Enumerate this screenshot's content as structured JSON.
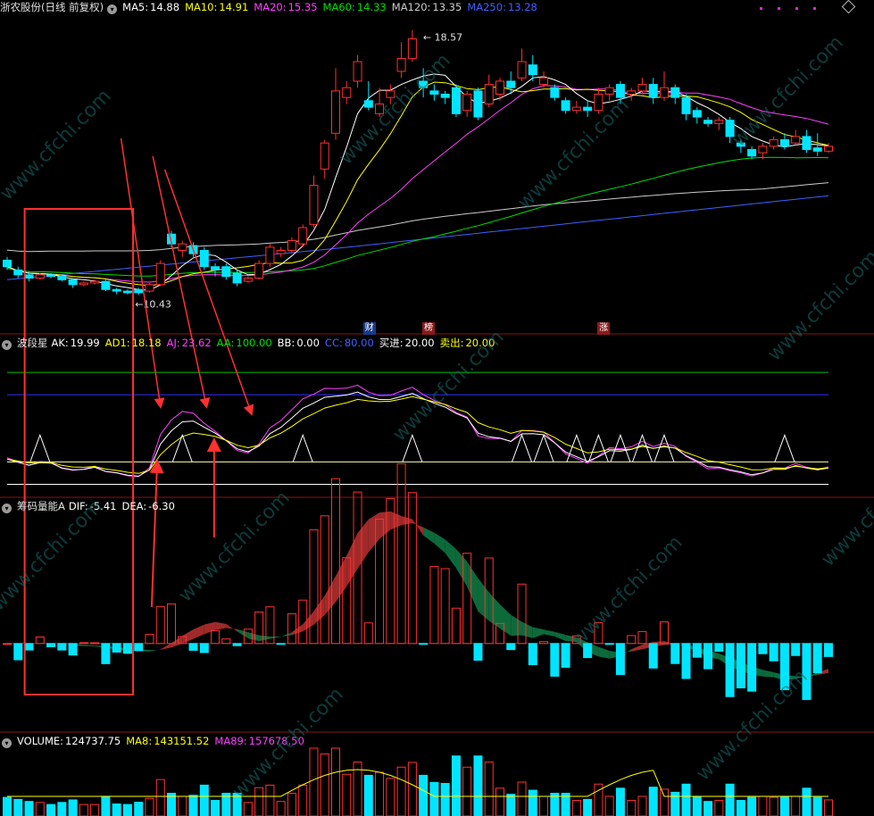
{
  "chart_data": {
    "type": "candlestick",
    "main_panel": {
      "title": "浙农股份(日线 前复权)",
      "indicators": [
        {
          "label": "MA5:",
          "value": "14.88",
          "color": "#ffffff"
        },
        {
          "label": "MA10:",
          "value": "14.91",
          "color": "#ffff00"
        },
        {
          "label": "MA20:",
          "value": "15.35",
          "color": "#ff40ff"
        },
        {
          "label": "MA60:",
          "value": "14.33",
          "color": "#00e000"
        },
        {
          "label": "MA120:",
          "value": "13.35",
          "color": "#cccccc"
        },
        {
          "label": "MA250:",
          "value": "13.28",
          "color": "#4060ff"
        }
      ],
      "ylim": [
        9.4,
        19.0
      ],
      "high_mark": "18.57",
      "low_mark": "10.43",
      "event_tags": [
        {
          "text": "财",
          "bg": "#1a3a8a"
        },
        {
          "text": "榜",
          "bg": "#8a1a1a"
        },
        {
          "text": "涨",
          "bg": "#8a1a1a"
        }
      ],
      "candles": [
        [
          11.5,
          11.3,
          11.6,
          11.2
        ],
        [
          11.2,
          11.05,
          11.3,
          10.95
        ],
        [
          11.05,
          10.95,
          11.15,
          10.85
        ],
        [
          10.95,
          11.05,
          11.1,
          10.9
        ],
        [
          11.05,
          11.0,
          11.1,
          10.95
        ],
        [
          11.0,
          10.9,
          11.05,
          10.85
        ],
        [
          10.9,
          10.75,
          10.95,
          10.65
        ],
        [
          10.75,
          10.8,
          10.85,
          10.7
        ],
        [
          10.8,
          10.85,
          10.9,
          10.75
        ],
        [
          10.85,
          10.6,
          10.9,
          10.55
        ],
        [
          10.6,
          10.55,
          10.65,
          10.45
        ],
        [
          10.55,
          10.5,
          10.6,
          10.45
        ],
        [
          10.6,
          10.5,
          10.65,
          10.43
        ],
        [
          10.55,
          10.75,
          10.8,
          10.5
        ],
        [
          10.75,
          11.4,
          11.5,
          10.7
        ],
        [
          12.3,
          12.0,
          12.4,
          11.9
        ],
        [
          11.8,
          12.0,
          12.1,
          11.6
        ],
        [
          11.95,
          11.7,
          12.05,
          11.6
        ],
        [
          11.8,
          11.3,
          11.9,
          11.2
        ],
        [
          11.3,
          11.2,
          11.4,
          11.0
        ],
        [
          11.3,
          11.0,
          11.4,
          10.9
        ],
        [
          11.1,
          10.8,
          11.2,
          10.7
        ],
        [
          10.85,
          10.95,
          11.0,
          10.8
        ],
        [
          10.95,
          11.4,
          11.5,
          10.9
        ],
        [
          11.4,
          11.9,
          12.0,
          11.3
        ],
        [
          11.7,
          11.8,
          11.9,
          11.6
        ],
        [
          11.8,
          12.1,
          12.2,
          11.7
        ],
        [
          12.0,
          12.5,
          12.6,
          11.9
        ],
        [
          12.6,
          13.8,
          14.1,
          12.5
        ],
        [
          14.3,
          15.1,
          15.2,
          14.0
        ],
        [
          15.4,
          16.7,
          17.4,
          15.2
        ],
        [
          16.5,
          16.8,
          17.0,
          16.3
        ],
        [
          17.0,
          17.6,
          17.8,
          16.8
        ],
        [
          16.4,
          16.2,
          17.0,
          16.1
        ],
        [
          16.0,
          16.3,
          16.8,
          15.9
        ],
        [
          16.5,
          16.7,
          16.9,
          16.3
        ],
        [
          17.3,
          17.7,
          18.2,
          17.1
        ],
        [
          17.7,
          18.3,
          18.57,
          17.6
        ],
        [
          17.0,
          16.8,
          17.4,
          16.5
        ],
        [
          16.7,
          16.6,
          16.9,
          16.4
        ],
        [
          16.6,
          16.5,
          16.7,
          16.3
        ],
        [
          16.8,
          16.0,
          16.9,
          15.9
        ],
        [
          16.1,
          16.6,
          16.7,
          15.9
        ],
        [
          16.7,
          15.9,
          16.8,
          15.8
        ],
        [
          16.3,
          16.9,
          17.2,
          16.2
        ],
        [
          16.6,
          17.0,
          17.1,
          16.4
        ],
        [
          17.0,
          16.8,
          17.3,
          16.6
        ],
        [
          17.1,
          17.6,
          18.0,
          17.0
        ],
        [
          17.5,
          17.2,
          17.8,
          17.0
        ],
        [
          16.9,
          17.1,
          17.3,
          16.8
        ],
        [
          16.8,
          16.5,
          16.9,
          16.4
        ],
        [
          16.4,
          16.1,
          16.5,
          16.0
        ],
        [
          16.1,
          16.2,
          16.4,
          16.0
        ],
        [
          16.2,
          16.1,
          16.4,
          15.9
        ],
        [
          16.1,
          16.6,
          16.8,
          16.0
        ],
        [
          16.6,
          16.8,
          16.9,
          16.4
        ],
        [
          16.9,
          16.5,
          17.0,
          16.3
        ],
        [
          16.6,
          16.7,
          16.8,
          16.4
        ],
        [
          16.7,
          16.9,
          17.1,
          16.6
        ],
        [
          16.9,
          16.5,
          17.1,
          16.3
        ],
        [
          16.5,
          16.8,
          17.3,
          16.4
        ],
        [
          16.8,
          16.5,
          16.9,
          16.3
        ],
        [
          16.5,
          16.0,
          16.6,
          15.8
        ],
        [
          16.1,
          15.9,
          16.2,
          15.7
        ],
        [
          15.8,
          15.7,
          15.9,
          15.6
        ],
        [
          15.7,
          15.8,
          15.9,
          15.5
        ],
        [
          15.8,
          15.3,
          15.9,
          15.1
        ],
        [
          15.1,
          15.0,
          15.2,
          14.8
        ],
        [
          14.9,
          14.7,
          15.0,
          14.6
        ],
        [
          14.8,
          15.0,
          15.1,
          14.6
        ],
        [
          15.0,
          15.2,
          15.3,
          14.9
        ],
        [
          15.2,
          15.0,
          15.4,
          14.9
        ],
        [
          15.1,
          15.3,
          15.5,
          15.0
        ],
        [
          15.3,
          14.9,
          15.5,
          14.8
        ],
        [
          14.95,
          14.85,
          15.4,
          14.7
        ],
        [
          14.85,
          15.0,
          15.1,
          14.8
        ]
      ]
    },
    "wave_panel": {
      "title": "波段星",
      "indicators": [
        {
          "label": "AK:",
          "value": "19.99",
          "color": "#ffffff"
        },
        {
          "label": "AD1:",
          "value": "18.18",
          "color": "#ffff00"
        },
        {
          "label": "AJ:",
          "value": "23.62",
          "color": "#ff40ff"
        },
        {
          "label": "AA:",
          "value": "100.00",
          "color": "#00e000"
        },
        {
          "label": "BB:",
          "value": "0.00",
          "color": "#ffffff"
        },
        {
          "label": "CC:",
          "value": "80.00",
          "color": "#4060ff"
        },
        {
          "label": "买进:",
          "value": "20.00",
          "color": "#ffffff"
        },
        {
          "label": "卖出:",
          "value": "20.00",
          "color": "#ffff00"
        }
      ],
      "ylim": [
        -10,
        120
      ],
      "reference_lines": [
        100,
        80,
        20,
        0
      ]
    },
    "chip_panel": {
      "title": "筹码量能A",
      "indicators": [
        {
          "label": "DIF:",
          "value": "-5.41",
          "color": "#ffffff"
        },
        {
          "label": "DEA:",
          "value": "-6.30",
          "color": "#ffffff"
        }
      ],
      "ylim": [
        -12,
        18
      ]
    },
    "volume_panel": {
      "title": "VOLUME:",
      "indicators": [
        {
          "label": "VOLUME:",
          "value": "124737.75",
          "color": "#ffffff"
        },
        {
          "label": "MA8:",
          "value": "143151.52",
          "color": "#ffff00"
        },
        {
          "label": "MA89:",
          "value": "157678.50",
          "color": "#ff40ff"
        }
      ]
    },
    "colors": {
      "up": "#ff3030",
      "down": "#00e5ff",
      "area_up": "#a02a2a",
      "area_down": "#0d6a3a",
      "annotation": "#ff3030"
    }
  },
  "watermark": "www.cfchi.com"
}
